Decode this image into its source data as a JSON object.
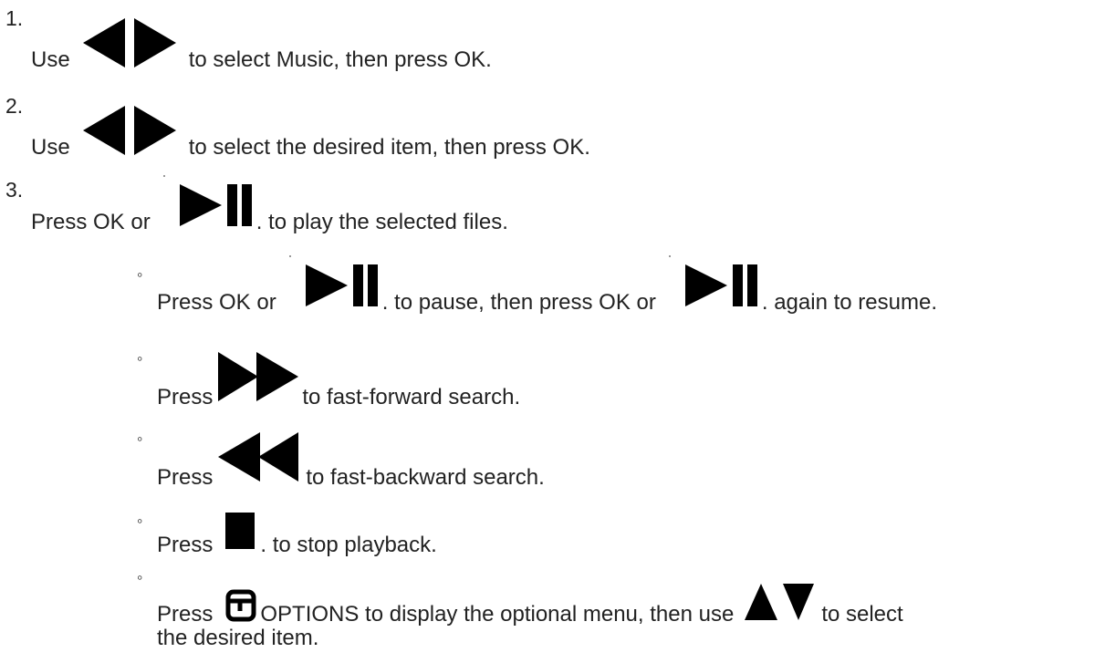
{
  "steps": [
    {
      "num": "1.",
      "pre": "Use",
      "post": "to select Music, then press OK.",
      "icon": "left-right-arrows-icon"
    },
    {
      "num": "2.",
      "pre": "Use",
      "post": "to select the desired item, then press OK.",
      "icon": "left-right-arrows-icon"
    },
    {
      "num": "3.",
      "pre": "Press OK or",
      "post": ". to play the selected files.",
      "icon": "play-pause-icon"
    }
  ],
  "bullets": {
    "marker": "◦",
    "pause": {
      "pre": "Press OK or",
      "mid": ". to pause, then press OK or",
      "post": ". again to resume.",
      "icon": "play-pause-icon"
    },
    "ff": {
      "pre": "Press",
      "post": "to fast-forward search.",
      "icon": "fast-forward-icon"
    },
    "rew": {
      "pre": "Press",
      "post": "to fast-backward search.",
      "icon": "fast-backward-icon"
    },
    "stop": {
      "pre": "Press",
      "post": ". to stop playback.",
      "icon": "stop-icon"
    },
    "options": {
      "pre": "Press",
      "mid": "OPTIONS to display the optional menu, then use",
      "post": "to select",
      "cont": "the desired item.",
      "icons": [
        "options-icon",
        "up-down-arrows-icon"
      ]
    }
  },
  "colors": {
    "text": "#222222",
    "icon": "#000000"
  }
}
